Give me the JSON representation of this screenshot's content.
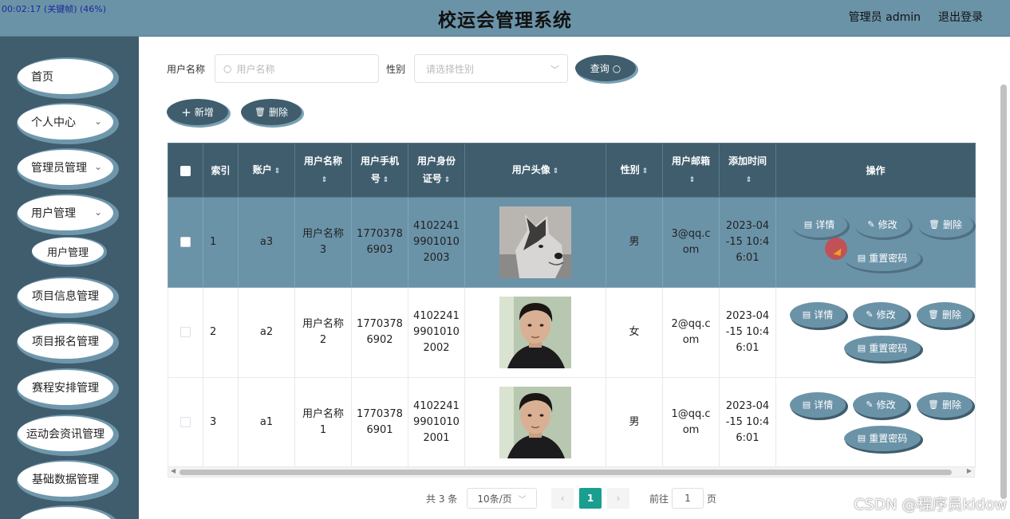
{
  "recording": "00:02:17 (关键帧) (46%)",
  "header": {
    "title": "校运会管理系统",
    "user": "管理员 admin",
    "logout": "退出登录"
  },
  "sidebar": {
    "items": [
      {
        "label": "首页",
        "chevron": false
      },
      {
        "label": "个人中心",
        "chevron": true
      },
      {
        "label": "管理员管理",
        "chevron": true
      },
      {
        "label": "用户管理",
        "chevron": true
      },
      {
        "label": "项目信息管理",
        "chevron": false
      },
      {
        "label": "项目报名管理",
        "chevron": false
      },
      {
        "label": "赛程安排管理",
        "chevron": false
      },
      {
        "label": "运动会资讯管理",
        "chevron": false
      },
      {
        "label": "基础数据管理",
        "chevron": false
      }
    ],
    "sub_item": "用户管理",
    "chevron_glyph": "⌄"
  },
  "search": {
    "username_label": "用户名称",
    "username_placeholder": "用户名称",
    "gender_label": "性别",
    "gender_placeholder": "请选择性别",
    "query_label": "查询"
  },
  "actions": {
    "add_label": "新增",
    "delete_label": "删除"
  },
  "table": {
    "headers": {
      "index": "索引",
      "account": "账户",
      "username_1": "用户名称",
      "phone_1": "用户手机",
      "phone_2": "号",
      "idcard_1": "用户身份",
      "idcard_2": "证号",
      "avatar": "用户头像",
      "gender": "性别",
      "email": "用户邮箱",
      "added_1": "添加时间",
      "ops": "操作"
    },
    "rows": [
      {
        "index": "1",
        "account": "a3",
        "name_1": "用户名称",
        "name_2": "3",
        "phone_1": "1770378",
        "phone_2": "6903",
        "id_1": "4102241",
        "id_2": "9901010",
        "id_3": "2003",
        "gender": "男",
        "email_1": "3@qq.c",
        "email_2": "om",
        "time_1": "2023-04",
        "time_2": "-15 10:4",
        "time_3": "6:01",
        "avatar": "husky"
      },
      {
        "index": "2",
        "account": "a2",
        "name_1": "用户名称",
        "name_2": "2",
        "phone_1": "1770378",
        "phone_2": "6902",
        "id_1": "4102241",
        "id_2": "9901010",
        "id_3": "2002",
        "gender": "女",
        "email_1": "2@qq.c",
        "email_2": "om",
        "time_1": "2023-04",
        "time_2": "-15 10:4",
        "time_3": "6:01",
        "avatar": "man"
      },
      {
        "index": "3",
        "account": "a1",
        "name_1": "用户名称",
        "name_2": "1",
        "phone_1": "1770378",
        "phone_2": "6901",
        "id_1": "4102241",
        "id_2": "9901010",
        "id_3": "2001",
        "gender": "男",
        "email_1": "1@qq.c",
        "email_2": "om",
        "time_1": "2023-04",
        "time_2": "-15 10:4",
        "time_3": "6:01",
        "avatar": "man"
      }
    ],
    "op_labels": {
      "detail": "详情",
      "edit": "修改",
      "delete": "删除",
      "reset": "重置密码"
    }
  },
  "pagination": {
    "total": "共 3 条",
    "page_size": "10条/页",
    "current": "1",
    "goto_label": "前往",
    "goto_value": "1",
    "page_unit": "页"
  },
  "watermark": "CSDN @程序员kidow",
  "colors": {
    "header": "#6b93a8",
    "sidebar": "#3f5d6d",
    "selected_row": "#6b93a8",
    "page_active": "#1a9e8f"
  }
}
